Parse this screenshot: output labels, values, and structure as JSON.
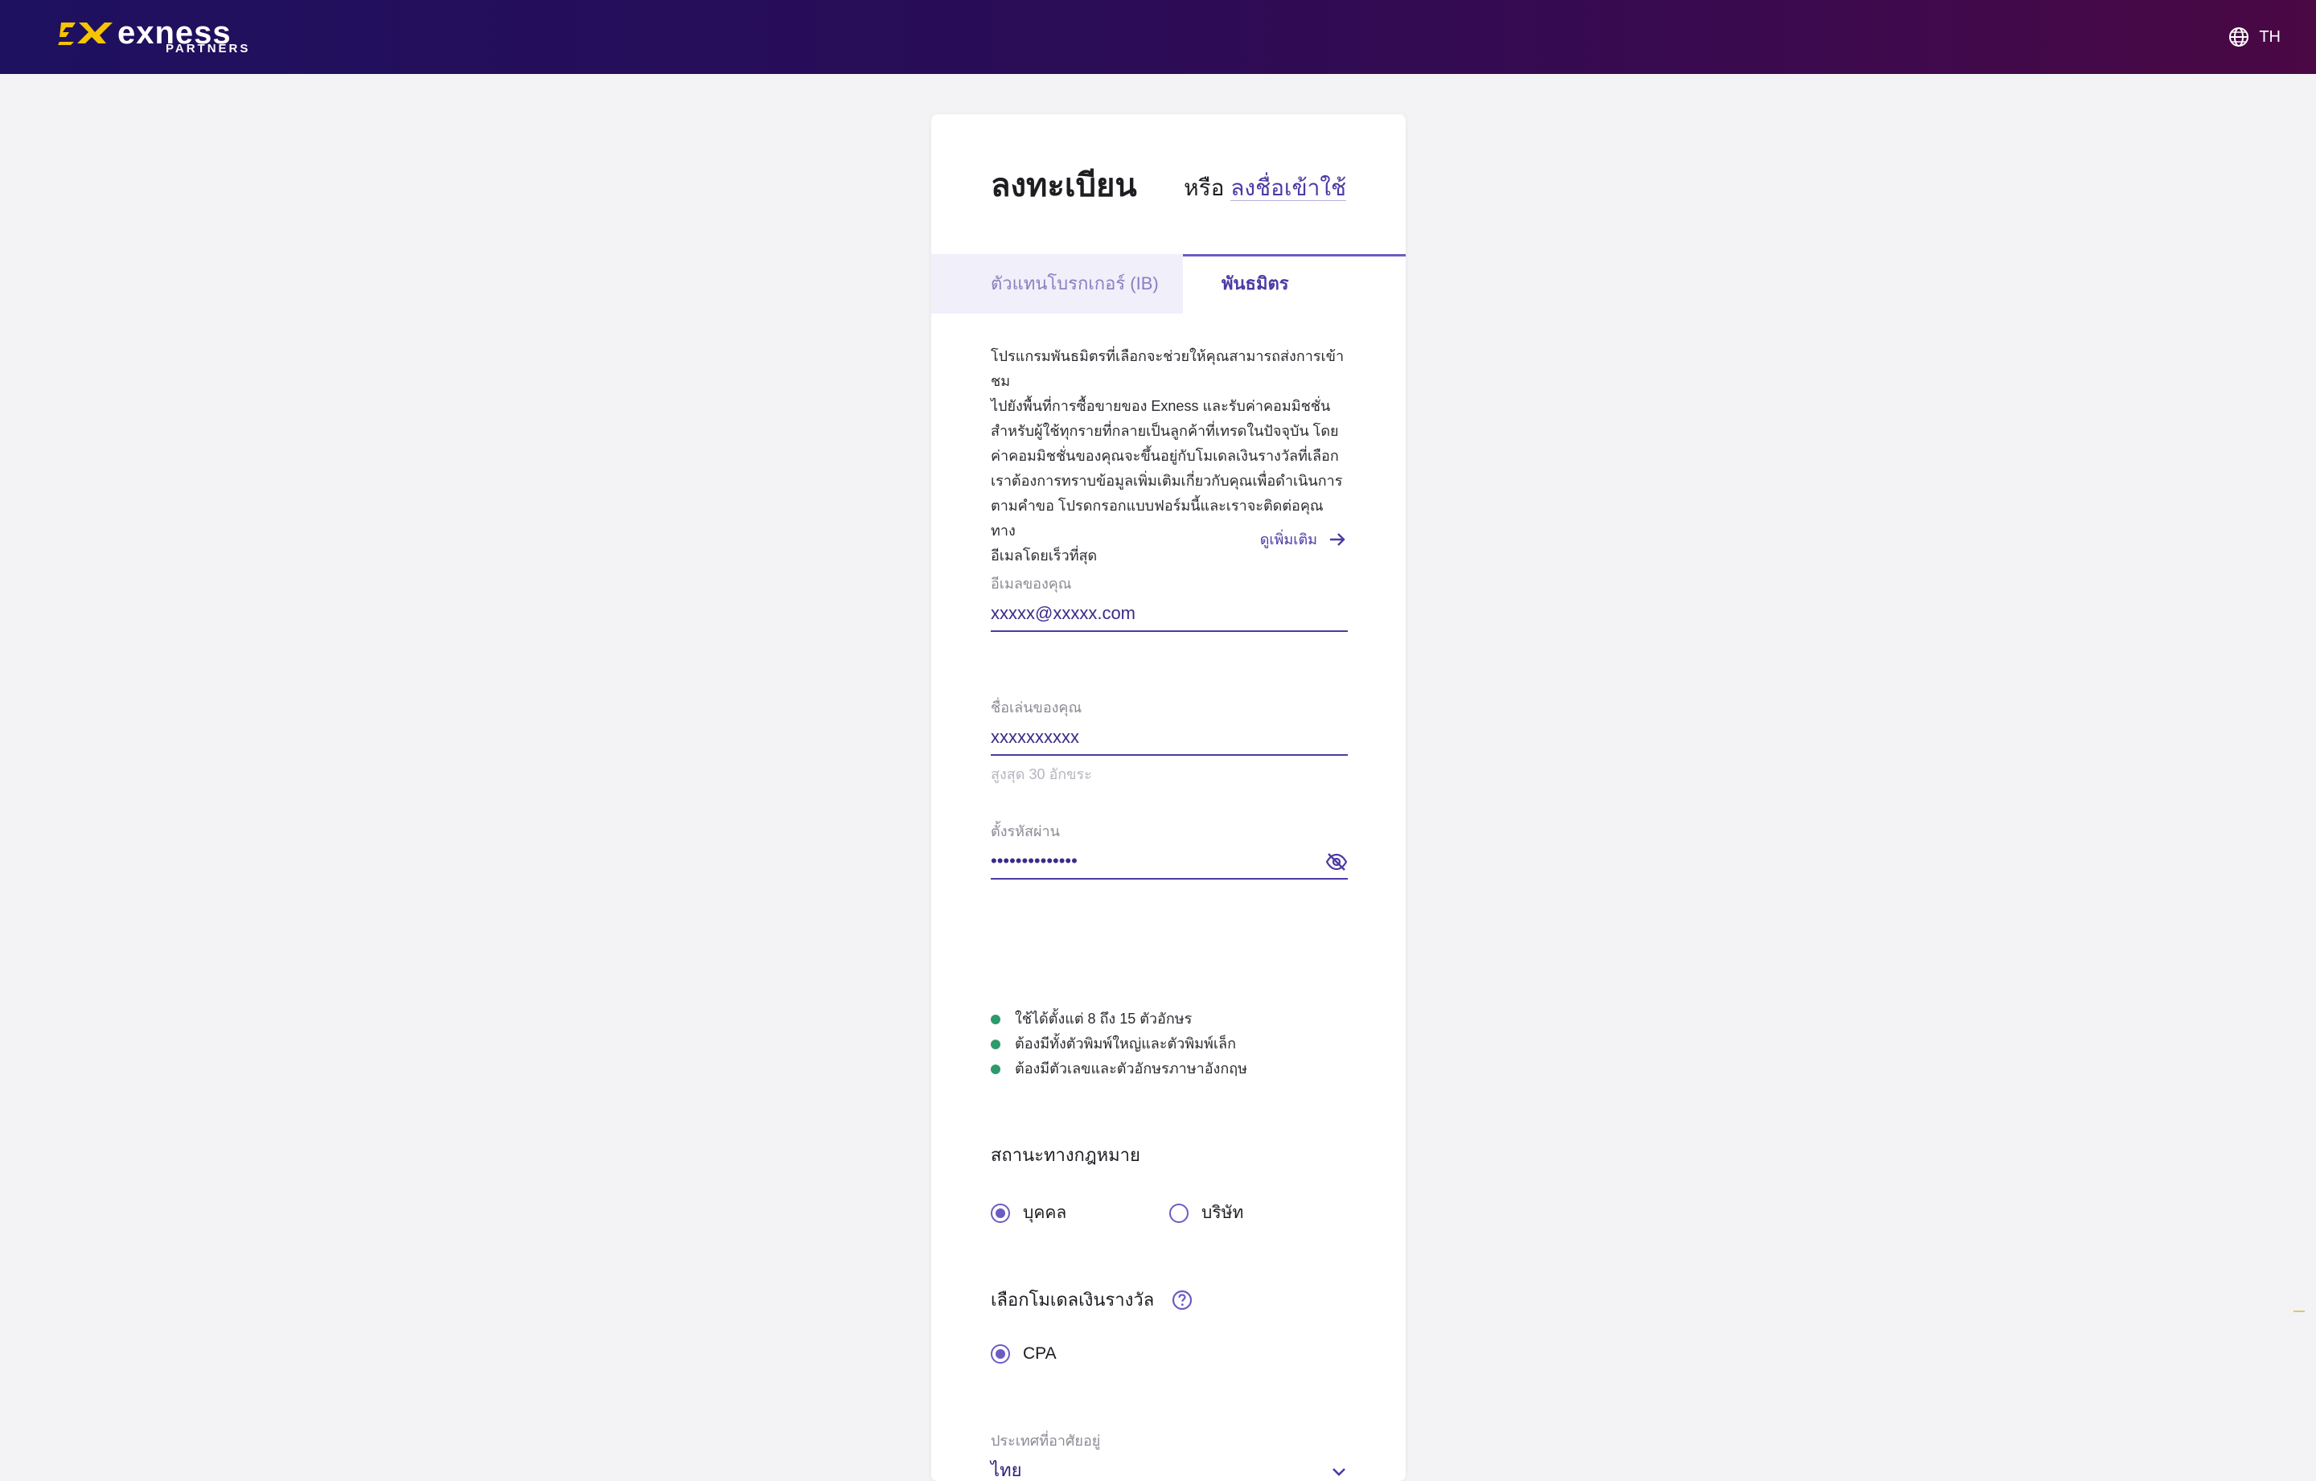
{
  "header": {
    "brand_name": "exness",
    "brand_sub": "PARTNERS",
    "language": "TH",
    "brand_color": "#f7c400",
    "gradient_colors": [
      "#1e1160",
      "#4a0844"
    ]
  },
  "card": {
    "title": "ลงทะเบียน",
    "or_text": "หรือ",
    "login_link": "ลงชื่อเข้าใช้",
    "tabs": [
      {
        "label": "ตัวแทนโบรกเกอร์ (IB)",
        "active": false
      },
      {
        "label": "พันธมิตร",
        "active": true
      }
    ],
    "description_lines": [
      "โปรแกรมพันธมิตรที่เลือกจะช่วยให้คุณสามารถส่งการเข้าชม",
      "ไปยังพื้นที่การซื้อขายของ Exness และรับค่าคอมมิชชั่น",
      "สำหรับผู้ใช้ทุกรายที่กลายเป็นลูกค้าที่เทรดในปัจจุบัน โดย",
      "ค่าคอมมิชชั่นของคุณจะขึ้นอยู่กับโมเดลเงินรางวัลที่เลือก",
      "เราต้องการทราบข้อมูลเพิ่มเติมเกี่ยวกับคุณเพื่อดำเนินการ",
      "ตามคำขอ โปรดกรอกแบบฟอร์มนี้และเราจะติดต่อคุณทาง",
      "อีเมลโดยเร็วที่สุด"
    ],
    "more_link": "ดูเพิ่มเติม",
    "email": {
      "label": "อีเมลของคุณ",
      "value": "xxxxx@xxxxx.com"
    },
    "nickname": {
      "label": "ชื่อเล่นของคุณ",
      "value": "xxxxxxxxxx",
      "hint": "สูงสุด 30 อักขระ"
    },
    "password": {
      "label": "ตั้งรหัสผ่าน",
      "value": "••••••••••••••",
      "rules": [
        "ใช้ได้ตั้งแต่ 8 ถึง 15 ตัวอักษร",
        "ต้องมีทั้งตัวพิมพ์ใหญ่และตัวพิมพ์เล็ก",
        "ต้องมีตัวเลขและตัวอักษรภาษาอังกฤษ"
      ]
    },
    "legal_status": {
      "title": "สถานะทางกฎหมาย",
      "options": [
        {
          "label": "บุคคล",
          "selected": true
        },
        {
          "label": "บริษัท",
          "selected": false
        }
      ]
    },
    "reward_model": {
      "title": "เลือกโมเดลเงินรางวัล",
      "options": [
        {
          "label": "CPA",
          "selected": true
        }
      ]
    },
    "country": {
      "label": "ประเทศที่อาศัยอยู่",
      "value": "ไทย"
    }
  }
}
